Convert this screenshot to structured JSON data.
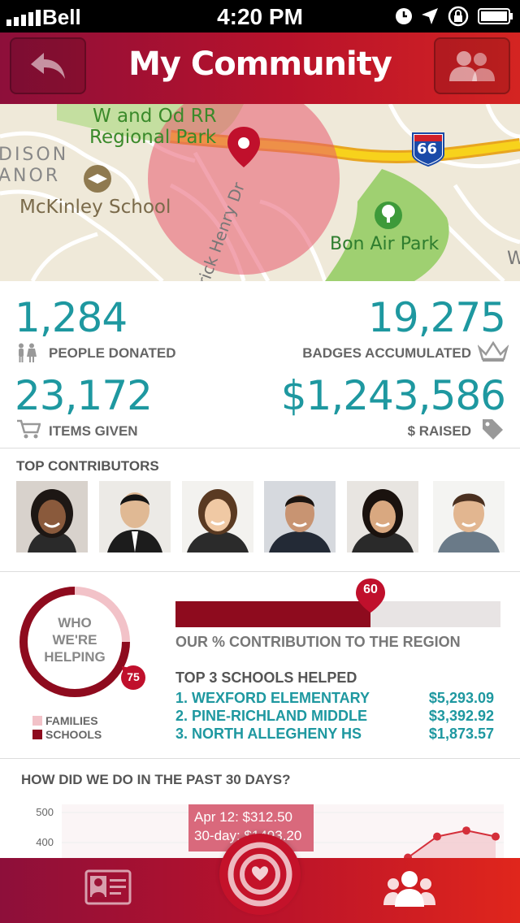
{
  "status_bar": {
    "carrier": "Bell",
    "time": "4:20 PM"
  },
  "header": {
    "title": "My Community",
    "back_icon": "undo-arrow-icon",
    "people_icon": "people-icon"
  },
  "map": {
    "labels": {
      "park1_line1": "W and Od RR",
      "park1_line2": "Regional Park",
      "area_line1": "DISON",
      "area_line2": "ANOR",
      "school": "McKinley School",
      "street": "rick Henry Dr",
      "park2": "Bon Air Park",
      "highway": "66",
      "edge_letter": "W"
    }
  },
  "stats": {
    "people_donated": {
      "value": "1,284",
      "label": "PEOPLE DONATED"
    },
    "badges": {
      "value": "19,275",
      "label": "BADGES ACCUMULATED"
    },
    "items": {
      "value": "23,172",
      "label": "ITEMS GIVEN"
    },
    "raised": {
      "value": "$1,243,586",
      "label": "$ RAISED"
    }
  },
  "contributors": {
    "title": "TOP CONTRIBUTORS",
    "count": 6
  },
  "helping": {
    "center_line1": "WHO",
    "center_line2": "WE'RE",
    "center_line3": "HELPING",
    "schools_percent": 75,
    "schools_percent_label": "75",
    "legend": [
      {
        "label": "FAMILIES",
        "color": "#f2c2c8"
      },
      {
        "label": "SCHOOLS",
        "color": "#8e0b1e"
      }
    ]
  },
  "region": {
    "percent": 60,
    "percent_label": "60",
    "caption": "OUR % CONTRIBUTION TO THE REGION"
  },
  "schools": {
    "title": "TOP 3 SCHOOLS HELPED",
    "items": [
      {
        "name": "1. WEXFORD ELEMENTARY",
        "amount": "$5,293.09"
      },
      {
        "name": "2. PINE-RICHLAND MIDDLE",
        "amount": "$3,392.92"
      },
      {
        "name": "3. NORTH ALLEGHENY HS",
        "amount": "$1,873.57"
      }
    ]
  },
  "past30": {
    "title": "HOW DID WE DO IN THE PAST 30 DAYS?",
    "tooltip_line1": "Apr 12: $312.50",
    "tooltip_line2": "30-day: $1493.20"
  },
  "chart_data": {
    "type": "area",
    "title": "HOW DID WE DO IN THE PAST 30 DAYS?",
    "yticks": [
      "500",
      "400"
    ],
    "ylim": [
      0,
      500
    ],
    "series": [
      {
        "values": [
          330,
          350,
          420,
          440,
          420
        ]
      }
    ],
    "accent_color": "#d42f3a"
  },
  "tabbar": {
    "left_icon": "id-card-icon",
    "center_icon": "heart-target-icon",
    "right_icon": "community-icon"
  },
  "colors": {
    "brand": "#b8122b",
    "teal": "#1e98a0"
  }
}
